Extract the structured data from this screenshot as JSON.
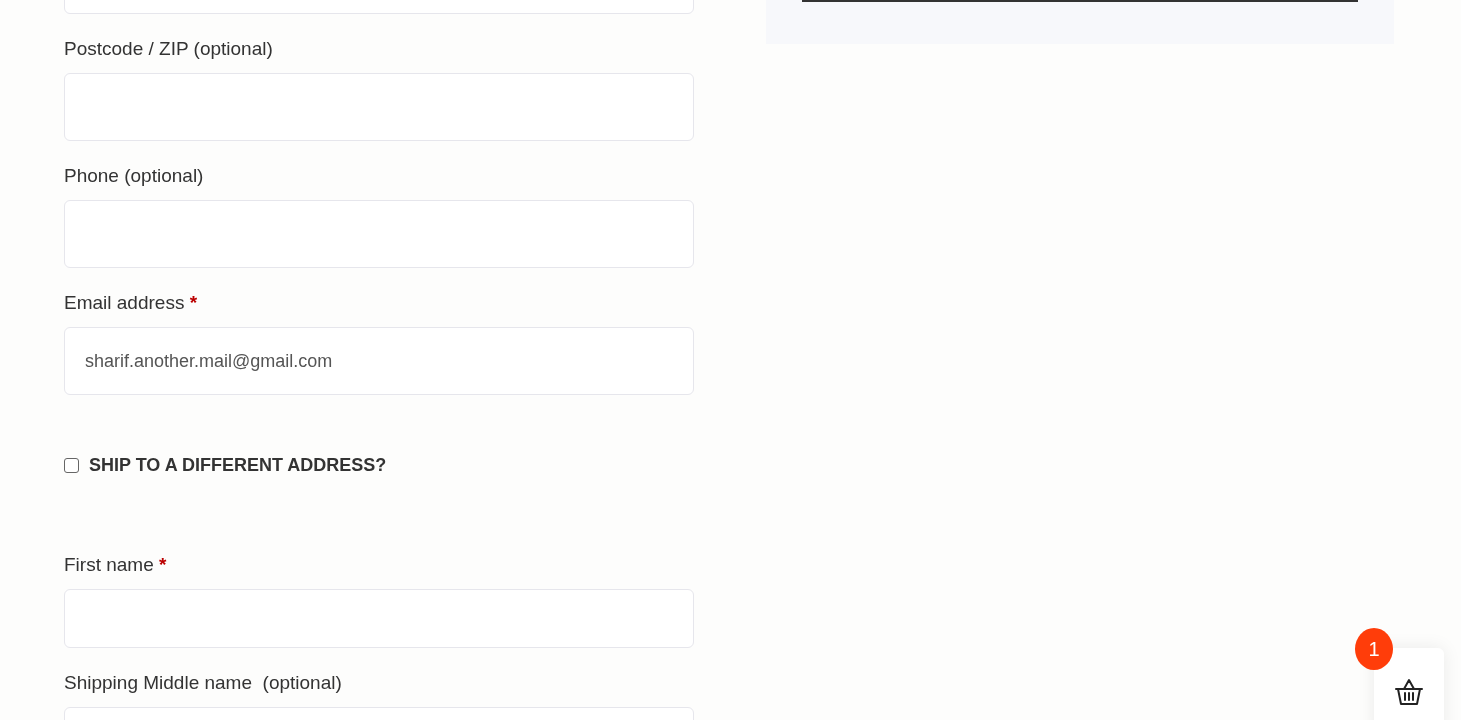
{
  "form": [
    {
      "kind": "field"
    },
    {
      "kind": "field",
      "label": "Postcode / ZIP (optional)"
    },
    {
      "kind": "field",
      "label": "Phone (optional)"
    },
    {
      "kind": "field",
      "label": "Email address",
      "required_mark": "*",
      "value": "sharif.another.mail@gmail.com"
    },
    {
      "kind": "checkbox",
      "label": "SHIP TO A DIFFERENT ADDRESS?",
      "checked": false
    },
    {
      "kind": "field",
      "label": "First name",
      "required_mark": "*"
    },
    {
      "kind": "field",
      "label": "Shipping Middle name  (optional)"
    }
  ],
  "cart": {
    "count": "1"
  }
}
